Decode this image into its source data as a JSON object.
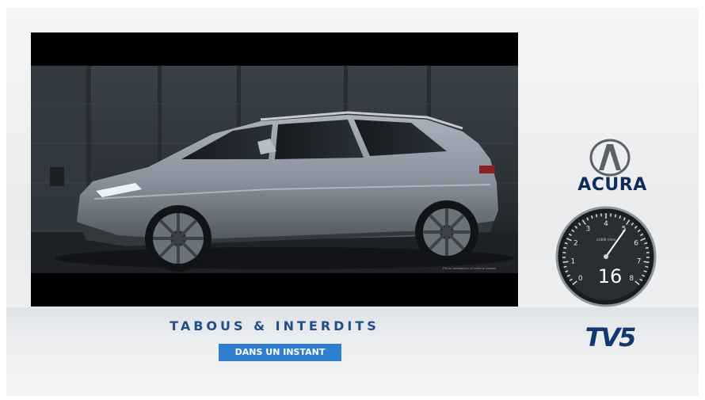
{
  "program": {
    "title": "TABOUS & INTERDITS",
    "status_badge": "DANS UN INSTANT"
  },
  "ad": {
    "brand": "ACURA",
    "brand_logo_icon": "acura-caliper-logo-icon",
    "disclaimer": "Photo simulation of vehicle shown"
  },
  "countdown": {
    "seconds": "16",
    "gauge_labels": [
      "0",
      "1",
      "2",
      "3",
      "4",
      "5",
      "6",
      "7",
      "8"
    ],
    "gauge_sub_label": "x1000 r/min"
  },
  "channel": {
    "logo_text": "TV5"
  },
  "colors": {
    "title_blue": "#1f4f86",
    "badge_blue": "#2f7fcf",
    "brand_navy": "#0d2c5a",
    "tv5_navy": "#12386e"
  }
}
